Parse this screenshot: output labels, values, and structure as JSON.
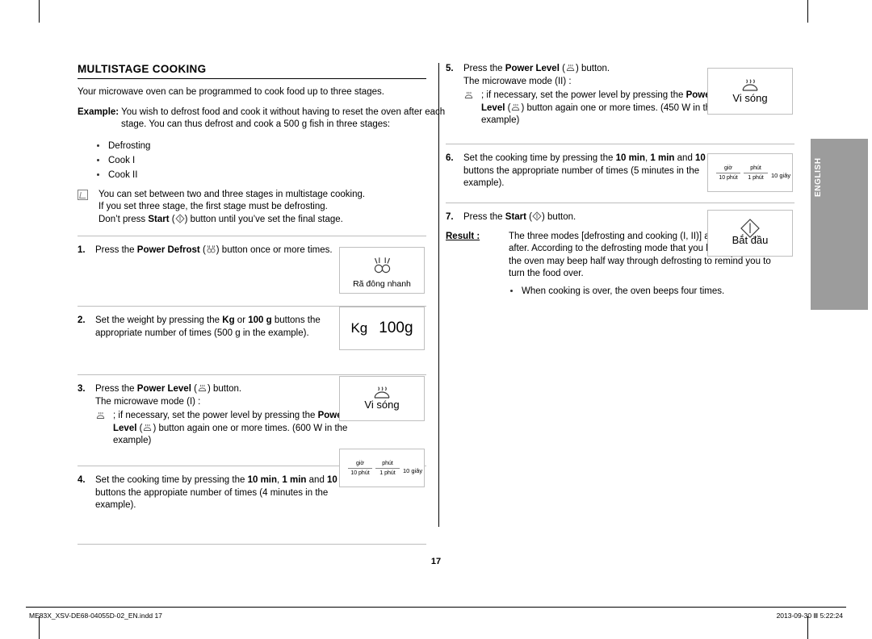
{
  "page": {
    "number": "17",
    "side_tab_label": "ENGLISH"
  },
  "left": {
    "title": "MULTISTAGE COOKING",
    "intro": "Your microwave oven can be programmed to cook food up to three stages.",
    "example_label": "Example:",
    "example_text": "You wish to defrost food and cook it without having to reset the oven after each stage. You can thus defrost and cook a 500 g fish in three stages:",
    "bullets": [
      "Defrosting",
      "Cook I",
      "Cook II"
    ],
    "note": "You can set between two and three stages in multistage cooking. If you set three stage, the first stage must be defrosting. Don’t press Start ( ) button until you’ve set the final stage.",
    "note_line1": "You can set between two and three stages in multistage cooking.",
    "note_line2": "If you set three stage, the first stage must be defrosting.",
    "note_line3_a": "Don’t press ",
    "note_line3_b": "Start",
    "note_line3_c": " (",
    "note_line3_d": ") button until you’ve set the final stage.",
    "steps": [
      {
        "num": "1.",
        "a": "Press the ",
        "b": "Power Defrost",
        "c": " (",
        "d": ") button once or more times."
      },
      {
        "num": "2.",
        "a": "Set the weight by pressing the ",
        "b": "Kg",
        "c": " or ",
        "d": "100 g",
        "e": " buttons the appropriate number of times (500 g in the example)."
      },
      {
        "num": "3.",
        "a": "Press the ",
        "b": "Power Level",
        "c": " (",
        "d": ") button.",
        "line2": "The microwave mode (I) :",
        "sub_a": "if necessary, set the power level by pressing the ",
        "sub_b": "Power Level",
        "sub_c": " (",
        "sub_d": ") button again one or more times. (600 W in the example)"
      },
      {
        "num": "4.",
        "a": "Set the cooking time by pressing the ",
        "b": "10 min",
        "c": ", ",
        "d": "1 min",
        "e": " and ",
        "f": "10 s",
        "g": " buttons the appropiate number of times (4 minutes in the example)."
      }
    ]
  },
  "right": {
    "steps": [
      {
        "num": "5.",
        "a": "Press the ",
        "b": "Power Level",
        "c": " (",
        "d": ") button.",
        "line2": "The microwave mode (II) :",
        "sub_a": "if necessary, set the power level by pressing the ",
        "sub_b": "Power Level",
        "sub_c": " (",
        "sub_d": ") button again one or more times. (450 W in the example)"
      },
      {
        "num": "6.",
        "a": "Set the cooking time by pressing the ",
        "b": "10 min",
        "c": ", ",
        "d": "1 min",
        "e": " and ",
        "f": "10 s",
        "g": " buttons the appropriate number of times (5 minutes in the example)."
      },
      {
        "num": "7.",
        "a": "Press the ",
        "b": "Start",
        "c": " (",
        "d": ") button."
      }
    ],
    "result_label": "Result :",
    "result_text": "The three modes [defrosting and cooking (I, II)] are selected on after. According to the defrosting mode that you have chosen, the oven may beep half way through defrosting to remind you to turn the food over.",
    "result_bullet": "When cooking is over, the oven beeps four times."
  },
  "panels": {
    "defrost": {
      "caption": "Rã đông nhanh"
    },
    "weight": {
      "kg": "Kg",
      "grams": "100g"
    },
    "power1": {
      "caption": "Vi sóng"
    },
    "power2": {
      "caption": "Vi sóng"
    },
    "time1": {
      "c1_top": "giờ",
      "c1_bot": "10 phút",
      "c2_top": "phút",
      "c2_bot": "1 phút",
      "c3": "10 giây"
    },
    "time2": {
      "c1_top": "giờ",
      "c1_bot": "10 phút",
      "c2_top": "phút",
      "c2_bot": "1 phút",
      "c3": "10 giây"
    },
    "start": {
      "caption": "Bắt đầu"
    }
  },
  "footer": {
    "left": "ME83X_XSV-DE68-04055D-02_EN.indd   17",
    "right": "2013-09-30   Ⅲ 5:22:24"
  }
}
